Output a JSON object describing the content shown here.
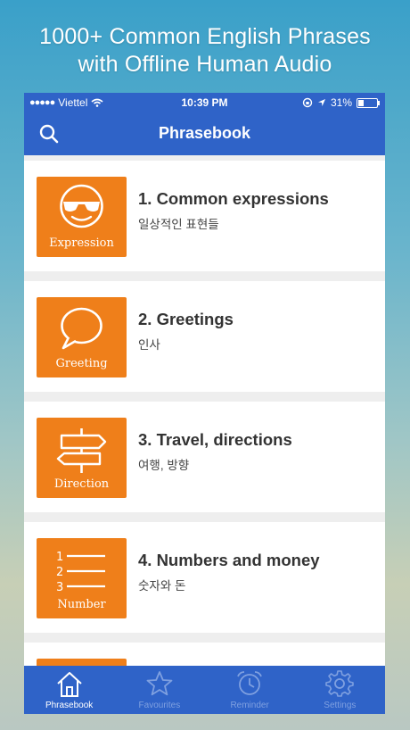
{
  "promo": {
    "line1": "1000+ Common English Phrases",
    "line2": "with Offline Human Audio"
  },
  "status": {
    "carrier": "Viettel",
    "time": "10:39 PM",
    "battery": "31%",
    "battery_level": 0.31
  },
  "navbar": {
    "title": "Phrasebook",
    "search_icon": "search-icon"
  },
  "categories": [
    {
      "title": "1. Common expressions",
      "subtitle": "일상적인 표현들",
      "tile_label": "Expression",
      "icon": "sunglasses-face-icon"
    },
    {
      "title": "2. Greetings",
      "subtitle": "인사",
      "tile_label": "Greeting",
      "icon": "speech-bubble-icon"
    },
    {
      "title": "3. Travel, directions",
      "subtitle": "여행, 방향",
      "tile_label": "Direction",
      "icon": "signpost-icon"
    },
    {
      "title": "4. Numbers and money",
      "subtitle": "숫자와 돈",
      "tile_label": "Number",
      "icon": "numbered-list-icon"
    }
  ],
  "tabs": [
    {
      "label": "Phrasebook",
      "icon": "home-icon",
      "active": true
    },
    {
      "label": "Favourites",
      "icon": "star-icon",
      "active": false
    },
    {
      "label": "Reminder",
      "icon": "alarm-clock-icon",
      "active": false
    },
    {
      "label": "Settings",
      "icon": "gear-icon",
      "active": false
    }
  ],
  "colors": {
    "accent": "#2f63c8",
    "tile": "#ef7f1a",
    "inactive_tab": "#7fa0e0"
  }
}
